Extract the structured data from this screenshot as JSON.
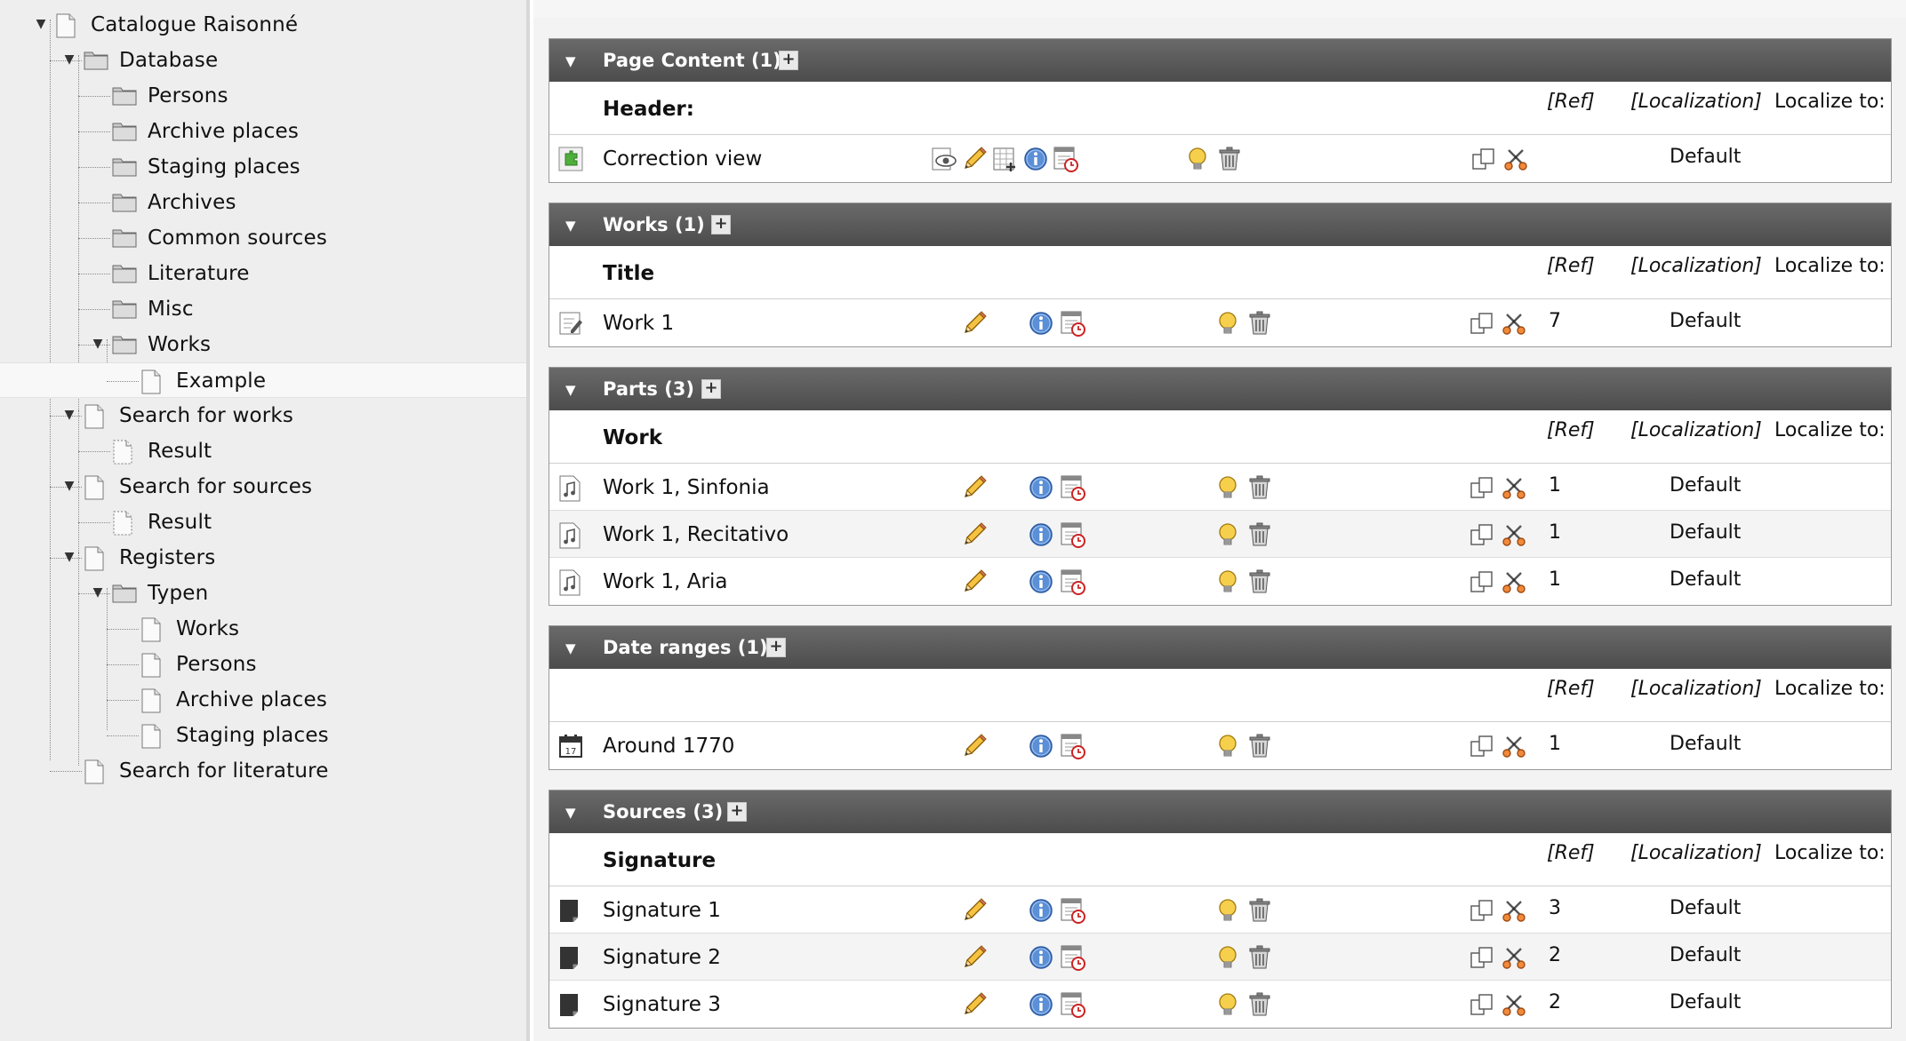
{
  "tree": {
    "items": [
      {
        "label": "Catalogue Raisonné",
        "type": "page",
        "expanded": true
      },
      {
        "label": "Database",
        "type": "folder",
        "expanded": true
      },
      {
        "label": "Persons",
        "type": "folder"
      },
      {
        "label": "Archive places",
        "type": "folder"
      },
      {
        "label": "Staging places",
        "type": "folder"
      },
      {
        "label": "Archives",
        "type": "folder"
      },
      {
        "label": "Common sources",
        "type": "folder"
      },
      {
        "label": "Literature",
        "type": "folder"
      },
      {
        "label": "Misc",
        "type": "folder"
      },
      {
        "label": "Works",
        "type": "folder",
        "expanded": true
      },
      {
        "label": "Example",
        "type": "page",
        "selected": true
      },
      {
        "label": "Search for works",
        "type": "page",
        "expanded": true
      },
      {
        "label": "Result",
        "type": "page-hidden"
      },
      {
        "label": "Search for sources",
        "type": "page",
        "expanded": true
      },
      {
        "label": "Result",
        "type": "page-hidden"
      },
      {
        "label": "Registers",
        "type": "page",
        "expanded": true
      },
      {
        "label": "Typen",
        "type": "folder",
        "expanded": true
      },
      {
        "label": "Works",
        "type": "page"
      },
      {
        "label": "Persons",
        "type": "page"
      },
      {
        "label": "Archive places",
        "type": "page"
      },
      {
        "label": "Staging places",
        "type": "page"
      },
      {
        "label": "Search for literature",
        "type": "page"
      }
    ]
  },
  "columns": {
    "ref": "[Ref]",
    "localization": "[Localization]",
    "localize_to": "Localize to:"
  },
  "panels": [
    {
      "title": "Page Content (1)",
      "column_title": "Header:",
      "records": [
        {
          "title": "Correction view",
          "icon": "plugin-icon",
          "ref": "",
          "localize": "Default",
          "variant": "content"
        }
      ]
    },
    {
      "title": "Works (1)",
      "column_title": "Title",
      "records": [
        {
          "title": "Work 1",
          "icon": "work-record-icon",
          "ref": "7",
          "localize": "Default"
        }
      ]
    },
    {
      "title": "Parts (3)",
      "column_title": "Work",
      "records": [
        {
          "title": "Work 1, Sinfonia",
          "icon": "music-note-icon",
          "ref": "1",
          "localize": "Default"
        },
        {
          "title": "Work 1, Recitativo",
          "icon": "music-note-icon",
          "ref": "1",
          "localize": "Default"
        },
        {
          "title": "Work 1, Aria",
          "icon": "music-note-icon",
          "ref": "1",
          "localize": "Default"
        }
      ]
    },
    {
      "title": "Date ranges (1)",
      "column_title": "",
      "records": [
        {
          "title": "Around 1770",
          "icon": "calendar-icon",
          "ref": "1",
          "localize": "Default"
        }
      ]
    },
    {
      "title": "Sources (3)",
      "column_title": "Signature",
      "records": [
        {
          "title": "Signature 1",
          "icon": "source-document-icon",
          "ref": "3",
          "localize": "Default"
        },
        {
          "title": "Signature 2",
          "icon": "source-document-icon",
          "ref": "2",
          "localize": "Default"
        },
        {
          "title": "Signature 3",
          "icon": "source-document-icon",
          "ref": "2",
          "localize": "Default"
        }
      ]
    }
  ],
  "colors": {
    "panel_header": "#555555",
    "tree_background": "#eeeeee",
    "info_blue": "#3f78c3",
    "delete_red": "#cc2222"
  }
}
